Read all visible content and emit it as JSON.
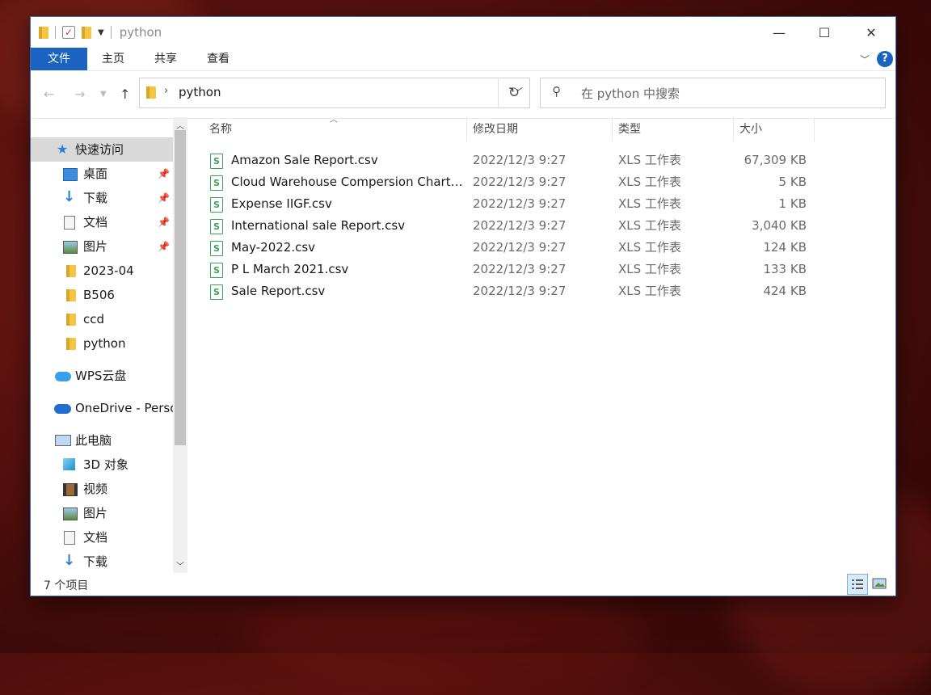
{
  "window": {
    "title": "python"
  },
  "window_controls": {
    "minimize": "—",
    "maximize": "☐",
    "close": "✕"
  },
  "ribbon": {
    "tabs": [
      {
        "label": "文件",
        "active": true
      },
      {
        "label": "主页"
      },
      {
        "label": "共享"
      },
      {
        "label": "查看"
      }
    ],
    "help": "?"
  },
  "address": {
    "path": "python",
    "search_placeholder": "在 python 中搜索"
  },
  "sidebar": {
    "items": [
      {
        "label": "快速访问",
        "icon": "star-icon"
      },
      {
        "label": "桌面",
        "icon": "desktop-icon",
        "pinned": true
      },
      {
        "label": "下载",
        "icon": "download-icon",
        "pinned": true
      },
      {
        "label": "文档",
        "icon": "document-icon",
        "pinned": true
      },
      {
        "label": "图片",
        "icon": "picture-icon",
        "pinned": true
      },
      {
        "label": "2023-04",
        "icon": "folder-icon"
      },
      {
        "label": "B506",
        "icon": "folder-icon"
      },
      {
        "label": "ccd",
        "icon": "folder-icon"
      },
      {
        "label": "python",
        "icon": "folder-icon"
      },
      {
        "label": "WPS云盘",
        "icon": "cloud-icon"
      },
      {
        "label": "OneDrive - Persc",
        "icon": "onedrive-icon"
      },
      {
        "label": "此电脑",
        "icon": "computer-icon"
      },
      {
        "label": "3D 对象",
        "icon": "3d-objects-icon"
      },
      {
        "label": "视频",
        "icon": "video-icon"
      },
      {
        "label": "图片",
        "icon": "picture-icon"
      },
      {
        "label": "文档",
        "icon": "document-icon"
      },
      {
        "label": "下载",
        "icon": "download-icon"
      }
    ]
  },
  "columns": {
    "name": "名称",
    "modified": "修改日期",
    "type": "类型",
    "size": "大小"
  },
  "files": [
    {
      "name": "Amazon Sale Report.csv",
      "modified": "2022/12/3 9:27",
      "type": "XLS 工作表",
      "size": "67,309 KB"
    },
    {
      "name": "Cloud Warehouse Compersion Chart....",
      "modified": "2022/12/3 9:27",
      "type": "XLS 工作表",
      "size": "5 KB"
    },
    {
      "name": "Expense IIGF.csv",
      "modified": "2022/12/3 9:27",
      "type": "XLS 工作表",
      "size": "1 KB"
    },
    {
      "name": "International sale Report.csv",
      "modified": "2022/12/3 9:27",
      "type": "XLS 工作表",
      "size": "3,040 KB"
    },
    {
      "name": "May-2022.csv",
      "modified": "2022/12/3 9:27",
      "type": "XLS 工作表",
      "size": "124 KB"
    },
    {
      "name": "P  L March 2021.csv",
      "modified": "2022/12/3 9:27",
      "type": "XLS 工作表",
      "size": "133 KB"
    },
    {
      "name": "Sale Report.csv",
      "modified": "2022/12/3 9:27",
      "type": "XLS 工作表",
      "size": "424 KB"
    }
  ],
  "file_icon_glyph": "S",
  "status": {
    "item_count": "7 个项目"
  },
  "colors": {
    "accent": "#1a63c0",
    "selection": "#d9d9d9",
    "file_icon": "#3aa35a"
  }
}
